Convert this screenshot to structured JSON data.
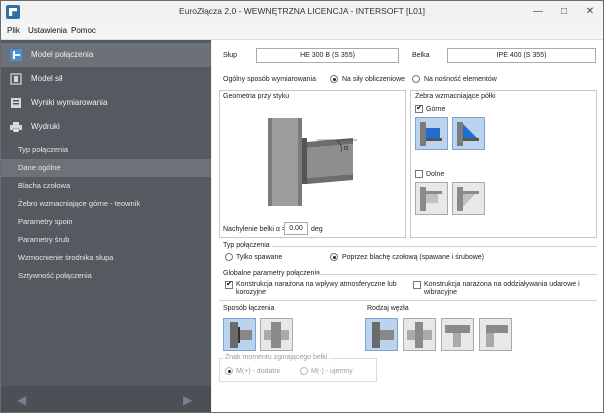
{
  "window": {
    "title": "EuroZłącza 2.0 - WEWNĘTRZNA LICENCJA - INTERSOFT [L01]"
  },
  "menu": {
    "items": [
      "Plik",
      "Ustawienia",
      "Pomoc"
    ]
  },
  "sidebar": {
    "main": [
      {
        "label": "Model połączenia",
        "icon": "connection-model-icon"
      },
      {
        "label": "Model sił",
        "icon": "forces-model-icon"
      },
      {
        "label": "Wyniki wymiarowania",
        "icon": "results-icon"
      },
      {
        "label": "Wydruki",
        "icon": "printer-icon"
      }
    ],
    "sub": [
      "Typ połączenia",
      "Dane ogólne",
      "Blacha czołowa",
      "Żebro wzmacniające górne - teownik",
      "Parametry spoin",
      "Parametry śrub",
      "Wzmocnienie środnika słupa",
      "Sztywność połączenia"
    ],
    "active_main": "Model połączenia",
    "active_sub": "Dane ogólne"
  },
  "content": {
    "column_label": "Słup",
    "column_value": "HE 300 B (S 355)",
    "beam_label": "Belka",
    "beam_value": "IPE 400 (S 355)",
    "dim_label": "Ogólny sposób wymiarowania",
    "dim_opt1": "Na siły obliczeniowe",
    "dim_opt2": "Na nośność elementów",
    "geometry_title": "Geometria przy styku",
    "alpha_symbol": "α",
    "slope_label": "Nachylenie belki α =",
    "slope_value": "0.00",
    "slope_unit": "deg",
    "ribs_title": "Żebra wzmacniające półki",
    "ribs_top": "Górne",
    "ribs_bottom": "Dolne",
    "conn_type_title": "Typ połączenia",
    "conn_opt1": "Tylko spawane",
    "conn_opt2": "Poprzez blachę czołową (spawane i śrubowe)",
    "global_title": "Globalne parametry połączenia",
    "global_opt1": "Konstrukcja narażona na wpływy atmosferyczne lub korozyjne",
    "global_opt2": "Konstrukcja narażona na oddziaływania udarowe i wibracyjne",
    "joining_title": "Sposób łączenia",
    "node_title": "Rodzaj węzła",
    "moment_title": "Znak momentu zginającego belki",
    "moment_opt1": "M(+) - dodatni",
    "moment_opt2": "M(-) - ujemny"
  },
  "colors": {
    "sidebar_bg": "#555a60",
    "sidebar_active": "#6c7077",
    "accent_blue": "#2f6fa8",
    "tile_selected": "#bcd3ee"
  }
}
